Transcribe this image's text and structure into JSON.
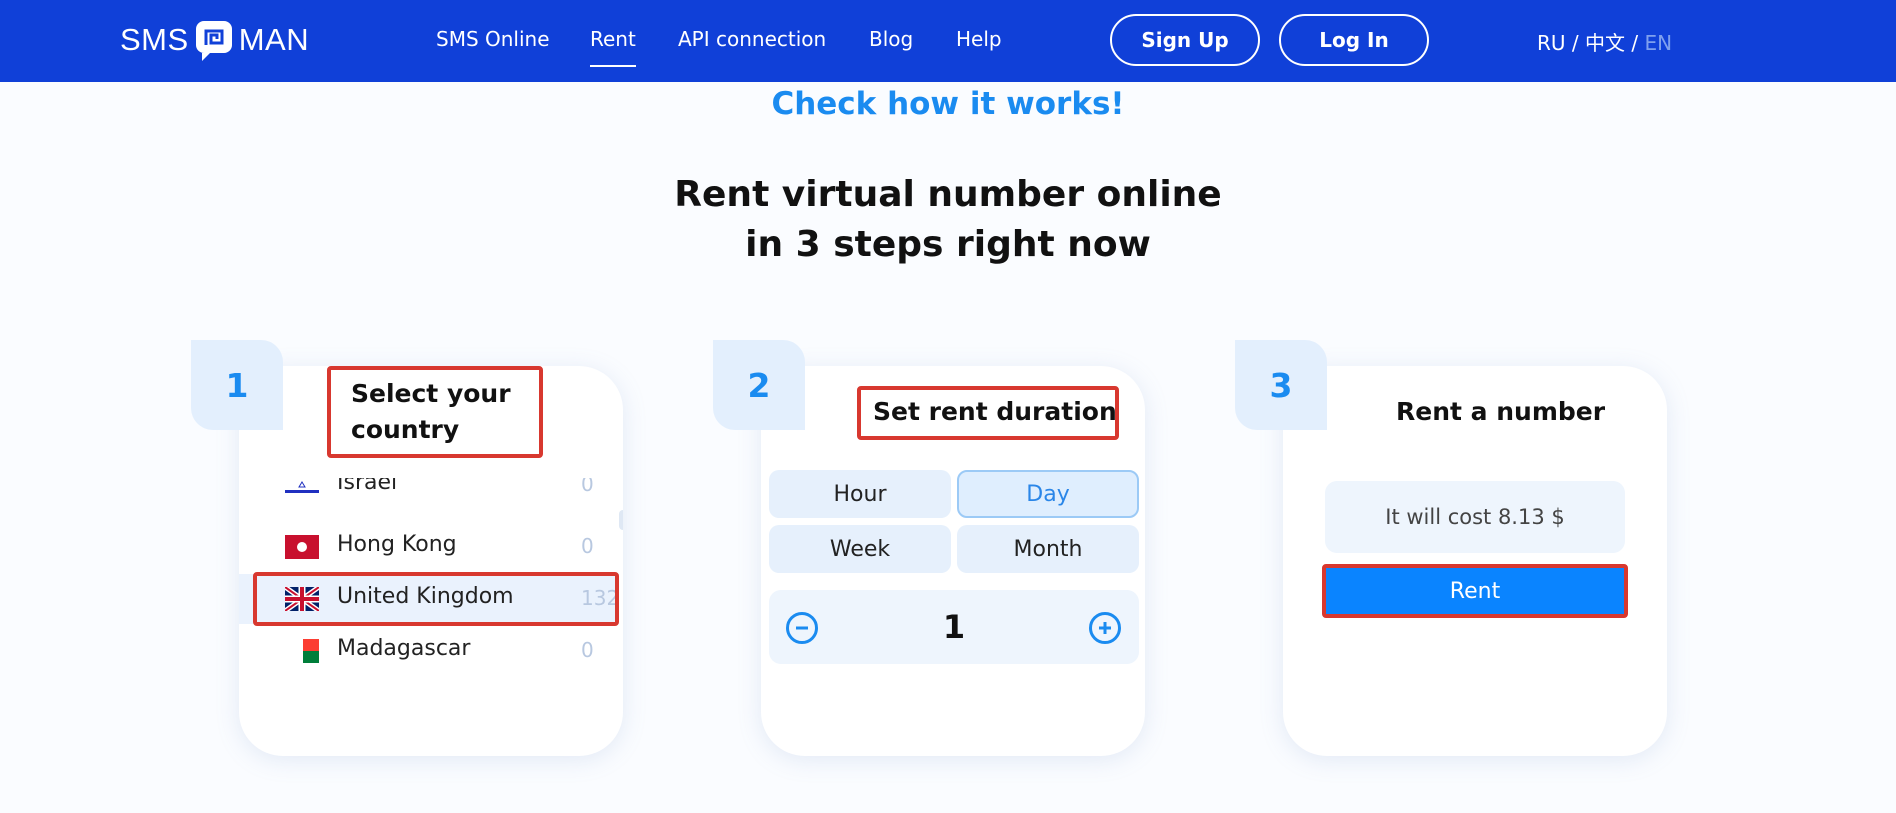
{
  "header": {
    "logo_left": "SMS",
    "logo_right": "MAN",
    "nav": [
      "SMS Online",
      "Rent",
      "API connection",
      "Blog",
      "Help"
    ],
    "active_nav": "Rent",
    "signup_label": "Sign Up",
    "login_label": "Log In",
    "lang": {
      "ru": "RU",
      "sep": "/",
      "zh": "中文",
      "en": "EN"
    }
  },
  "hero": {
    "check_label": "Check how it works!",
    "title_line1": "Rent virtual number online",
    "title_line2": "in 3 steps right now"
  },
  "steps": [
    {
      "number": "1",
      "title_line1": "Select your",
      "title_line2": "country",
      "countries": [
        {
          "name": "Israel",
          "count": "0",
          "flag": "israel-flag-icon"
        },
        {
          "name": "Hong Kong",
          "count": "0",
          "flag": "hong-kong-flag-icon"
        },
        {
          "name": "United Kingdom",
          "count": "132",
          "flag": "uk-flag-icon",
          "selected": true
        },
        {
          "name": "Madagascar",
          "count": "0",
          "flag": "madagascar-flag-icon"
        }
      ]
    },
    {
      "number": "2",
      "title": "Set rent duration",
      "durations": [
        "Hour",
        "Day",
        "Week",
        "Month"
      ],
      "selected_duration": "Day",
      "quantity": "1"
    },
    {
      "number": "3",
      "title": "Rent a number",
      "cost_text": "It will cost 8.13 $",
      "rent_label": "Rent"
    }
  ],
  "colors": {
    "header_bg": "#1040d8",
    "accent": "#1a8bf0",
    "highlight_box": "#d8382f",
    "rent_button": "#0a84ff"
  }
}
